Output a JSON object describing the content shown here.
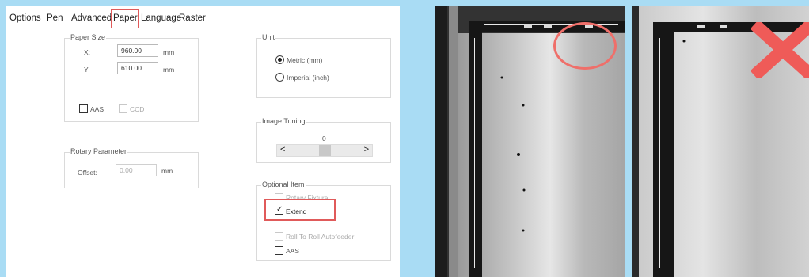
{
  "tabs": [
    "Options",
    "Pen",
    "Advanced",
    "Paper",
    "Language",
    "Raster"
  ],
  "active_tab": "Paper",
  "paper_size": {
    "title": "Paper Size",
    "x_label": "X:",
    "x_value": "960.00",
    "y_label": "Y:",
    "y_value": "610.00",
    "unit": "mm",
    "aas_label": "AAS",
    "ccd_label": "CCD"
  },
  "rotary": {
    "title": "Rotary Parameter",
    "offset_label": "Offset:",
    "offset_value": "0.00",
    "unit": "mm"
  },
  "unit_group": {
    "title": "Unit",
    "metric_label": "Metric (mm)",
    "imperial_label": "Imperial (inch)",
    "selected": "Metric (mm)"
  },
  "image_tuning": {
    "title": "Image Tuning",
    "value": "0",
    "left_arrow": "<",
    "right_arrow": ">",
    "position_fraction": 0.5
  },
  "optional_item": {
    "title": "Optional Item",
    "rotary_fixture_label": "Rotary Fixture",
    "extend_label": "Extend",
    "extend_checked": true,
    "roll_label": "Roll To Roll  Autofeeder",
    "aas_label": "AAS"
  },
  "colors": {
    "background": "#a9dcf4",
    "highlight": "#e05a5a",
    "x_mark": "#ef5b58"
  },
  "icons": [
    "circle-highlight-icon",
    "x-mark-icon"
  ]
}
